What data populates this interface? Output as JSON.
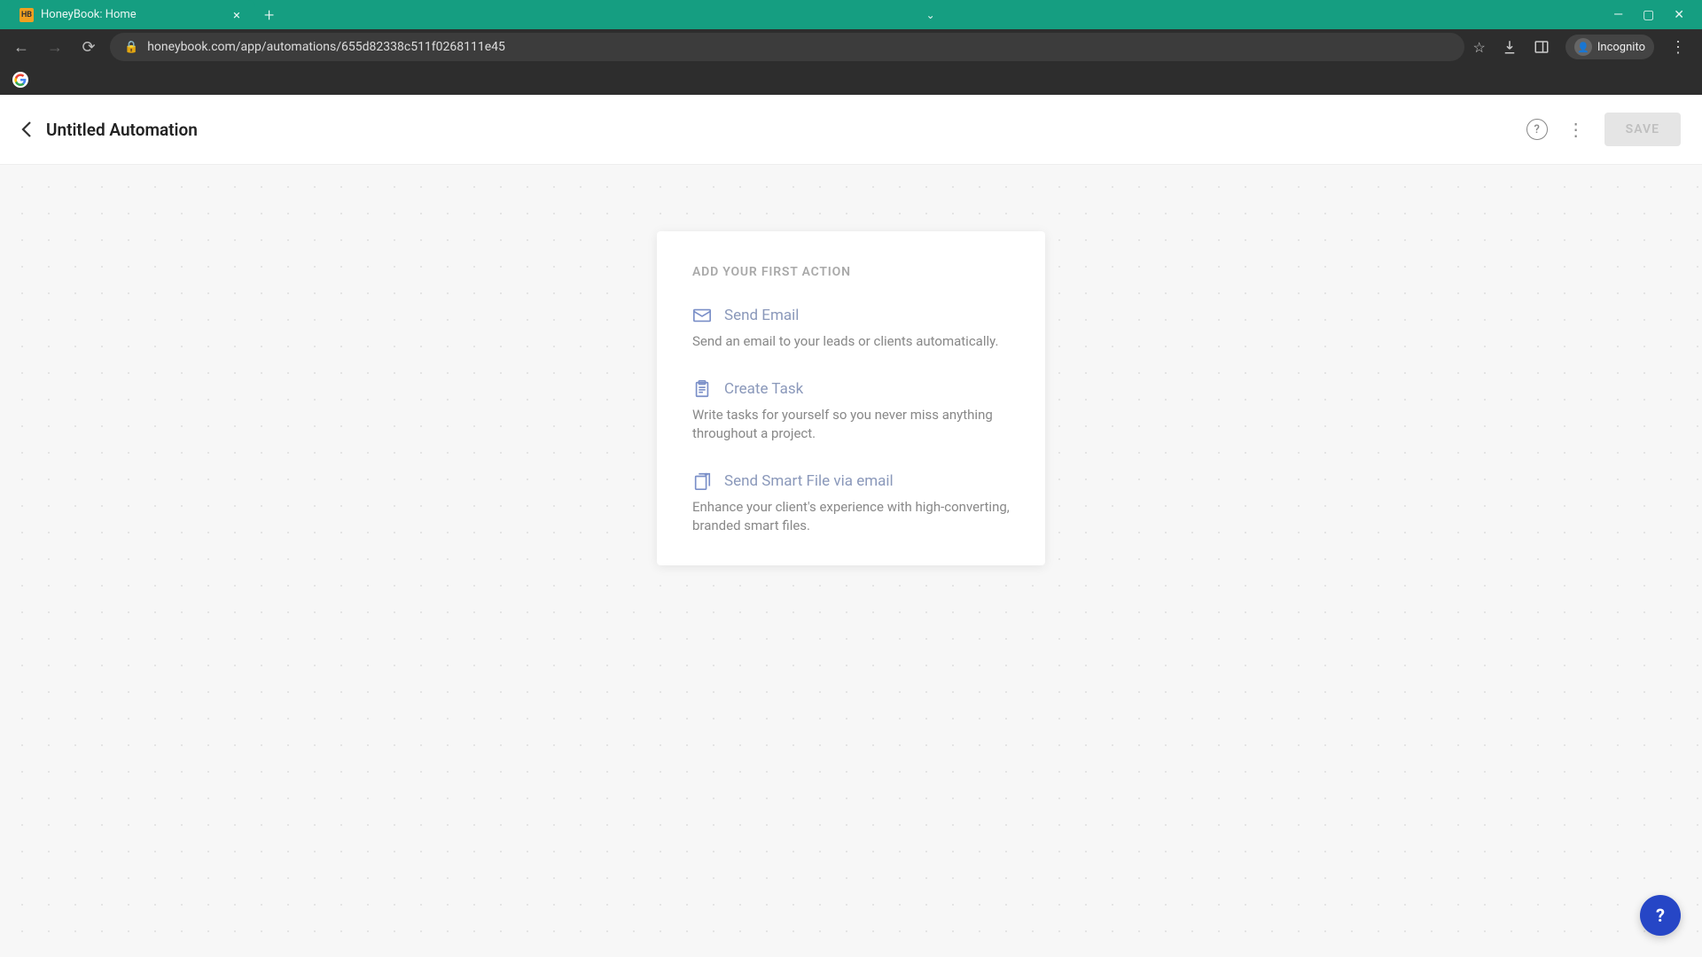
{
  "browser": {
    "tab_title": "HoneyBook: Home",
    "url": "honeybook.com/app/automations/655d82338c511f0268111e45",
    "incognito_label": "Incognito"
  },
  "header": {
    "page_title": "Untitled Automation",
    "save_label": "SAVE"
  },
  "card": {
    "heading": "ADD YOUR FIRST ACTION",
    "actions": [
      {
        "title": "Send Email",
        "description": "Send an email to your leads or clients automatically."
      },
      {
        "title": "Create Task",
        "description": "Write tasks for yourself so you never miss anything throughout a project."
      },
      {
        "title": "Send Smart File via email",
        "description": "Enhance your client's experience with high-converting, branded smart files."
      }
    ]
  },
  "help_fab": "?"
}
